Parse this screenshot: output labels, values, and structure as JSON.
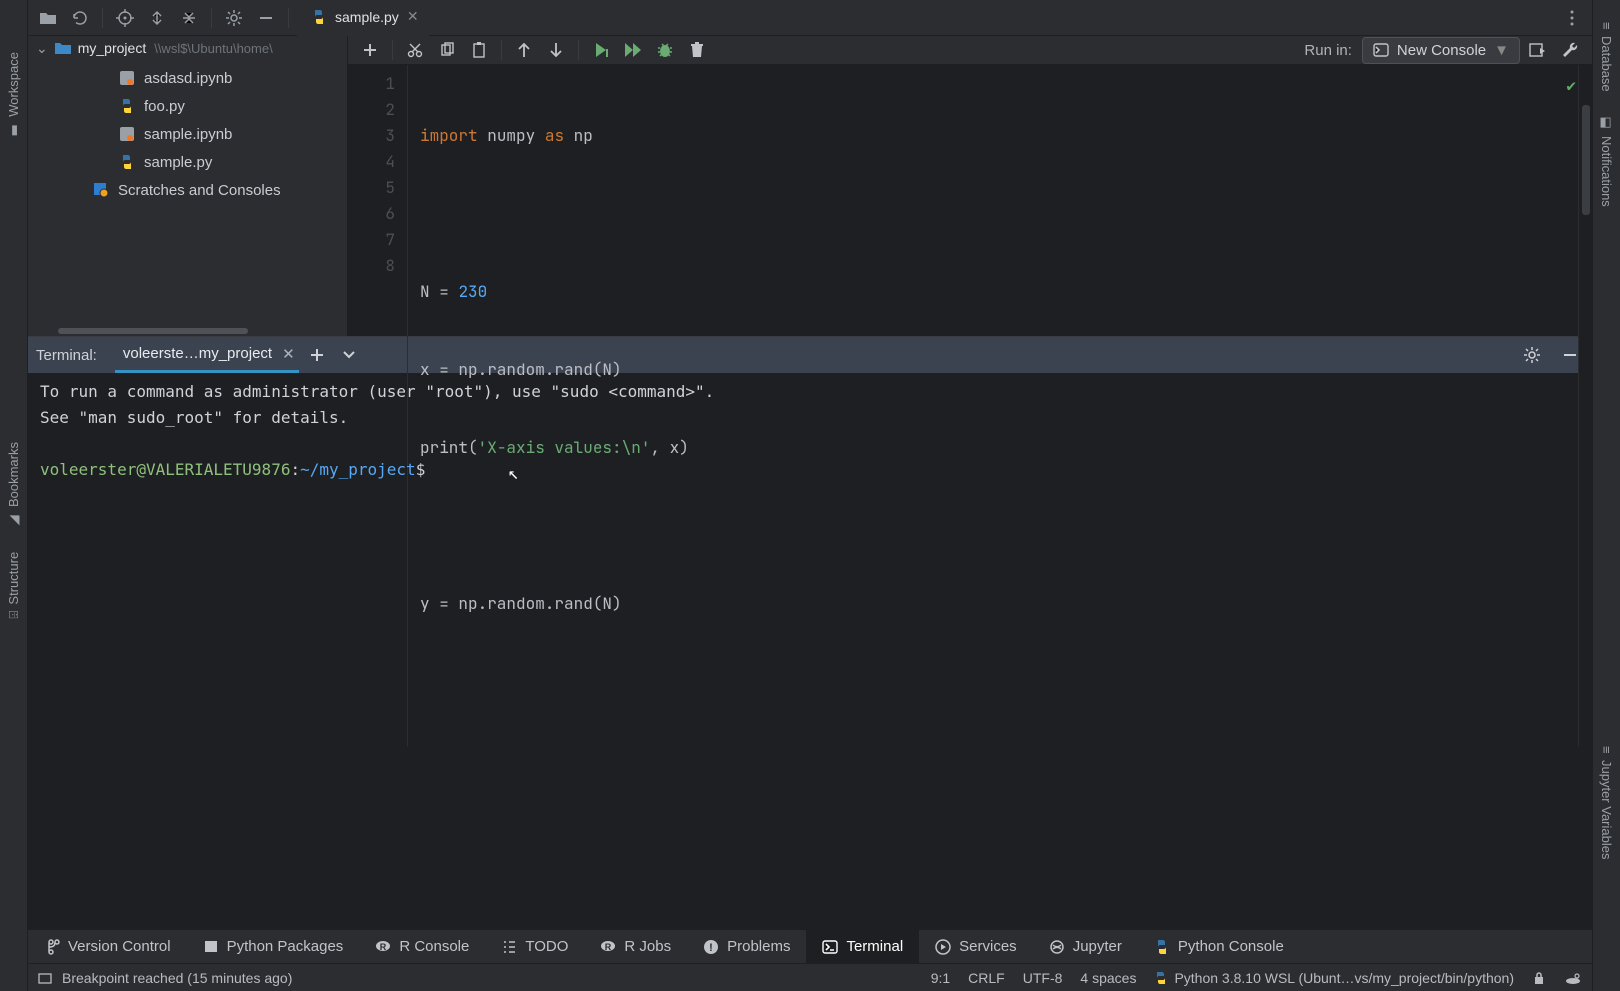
{
  "toolbar": {
    "tab_name": "sample.py",
    "run_in_label": "Run in:",
    "run_in_value": "New Console"
  },
  "project": {
    "name": "my_project",
    "path": "\\\\wsl$\\Ubuntu\\home\\",
    "files": [
      {
        "name": "asdasd.ipynb",
        "icon": "jupyter"
      },
      {
        "name": "foo.py",
        "icon": "python"
      },
      {
        "name": "sample.ipynb",
        "icon": "jupyter"
      },
      {
        "name": "sample.py",
        "icon": "python"
      }
    ],
    "scratches": "Scratches and Consoles"
  },
  "left_rail": {
    "workspace": "Workspace",
    "bookmarks": "Bookmarks",
    "structure": "Structure"
  },
  "right_rail": {
    "database": "Database",
    "notifications": "Notifications",
    "jupyter_vars": "Jupyter Variables"
  },
  "code": {
    "lines": [
      "import numpy as np",
      "",
      "N = 230",
      "x = np.random.rand(N)",
      "print('X-axis values:\\n', x)",
      "",
      "y = np.random.rand(N)",
      ""
    ]
  },
  "terminal": {
    "label": "Terminal:",
    "tab": "voleerste…my_project",
    "output": [
      "To run a command as administrator (user \"root\"), use \"sudo <command>\".",
      "See \"man sudo_root\" for details.",
      ""
    ],
    "prompt_user": "voleerster@VALERIALETU9876",
    "prompt_sep": ":",
    "prompt_path": "~/my_project",
    "prompt_symbol": "$"
  },
  "bottom_tools": {
    "version_control": "Version Control",
    "python_packages": "Python Packages",
    "r_console": "R Console",
    "todo": "TODO",
    "r_jobs": "R Jobs",
    "problems": "Problems",
    "terminal": "Terminal",
    "services": "Services",
    "jupyter": "Jupyter",
    "python_console": "Python Console"
  },
  "status": {
    "breakpoint": "Breakpoint reached (15 minutes ago)",
    "cursor": "9:1",
    "line_sep": "CRLF",
    "encoding": "UTF-8",
    "indent": "4 spaces",
    "interpreter": "Python 3.8.10 WSL (Ubunt…vs/my_project/bin/python)"
  }
}
